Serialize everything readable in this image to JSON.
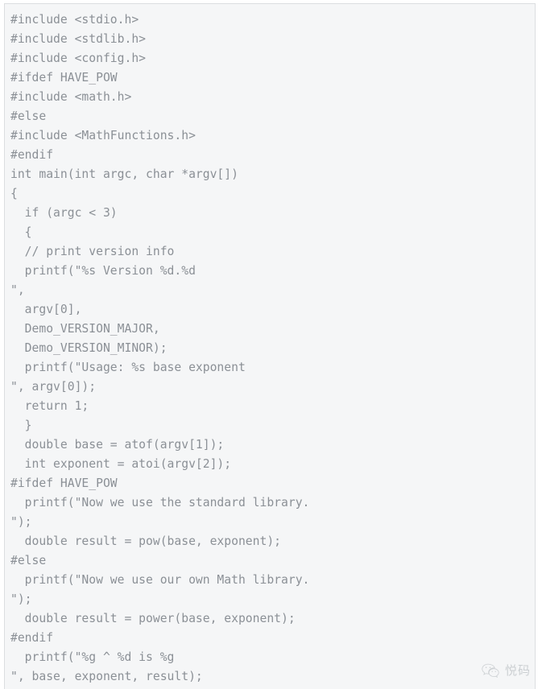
{
  "code_block": {
    "language": "c",
    "background_color": "#f5f6f7",
    "text_color": "#8b9096",
    "border_color": "#dcdee0",
    "lines": [
      "#include <stdio.h>",
      "#include <stdlib.h>",
      "#include <config.h>",
      "#ifdef HAVE_POW",
      "#include <math.h>",
      "#else",
      "#include <MathFunctions.h>",
      "#endif",
      "int main(int argc, char *argv[])",
      "{",
      "  if (argc < 3)",
      "  {",
      "  // print version info",
      "  printf(\"%s Version %d.%d",
      "\",",
      "  argv[0],",
      "  Demo_VERSION_MAJOR,",
      "  Demo_VERSION_MINOR);",
      "  printf(\"Usage: %s base exponent",
      "\", argv[0]);",
      "  return 1;",
      "  }",
      "  double base = atof(argv[1]);",
      "  int exponent = atoi(argv[2]);",
      "#ifdef HAVE_POW",
      "  printf(\"Now we use the standard library.",
      "\");",
      "  double result = pow(base, exponent);",
      "#else",
      "  printf(\"Now we use our own Math library.",
      "\");",
      "  double result = power(base, exponent);",
      "#endif",
      "  printf(\"%g ^ %d is %g",
      "\", base, exponent, result);"
    ]
  },
  "watermark": {
    "icon": "wechat-logo-icon",
    "label": "悦码",
    "color": "#9aa0a6"
  }
}
